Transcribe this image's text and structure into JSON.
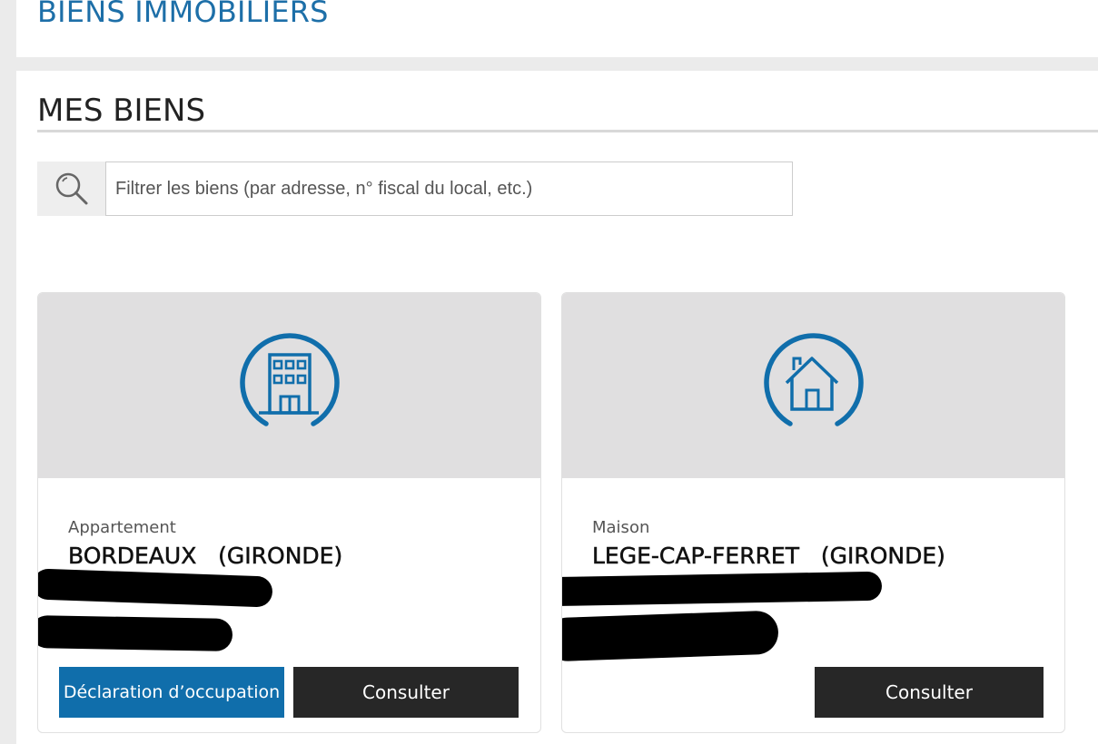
{
  "header": {
    "title": "BIENS IMMOBILIERS"
  },
  "section": {
    "title": "MES BIENS"
  },
  "search": {
    "placeholder": "Filtrer les biens (par adresse, n° fiscal du local, etc.)",
    "value": ""
  },
  "properties": [
    {
      "icon": "apartment-building-icon",
      "type": "Appartement",
      "city": "BORDEAUX   (GIRONDE)",
      "actions": {
        "declaration_label": "Déclaration d’occupation",
        "consult_label": "Consulter"
      }
    },
    {
      "icon": "house-icon",
      "type": "Maison",
      "city": "LEGE-CAP-FERRET   (GIRONDE)",
      "actions": {
        "consult_label": "Consulter"
      }
    }
  ],
  "colors": {
    "accent": "#106eab",
    "title_blue": "#1d6fa8",
    "dark_button": "#272727",
    "card_visual_bg": "#e0dfe0",
    "page_bg": "#ebebeb"
  }
}
